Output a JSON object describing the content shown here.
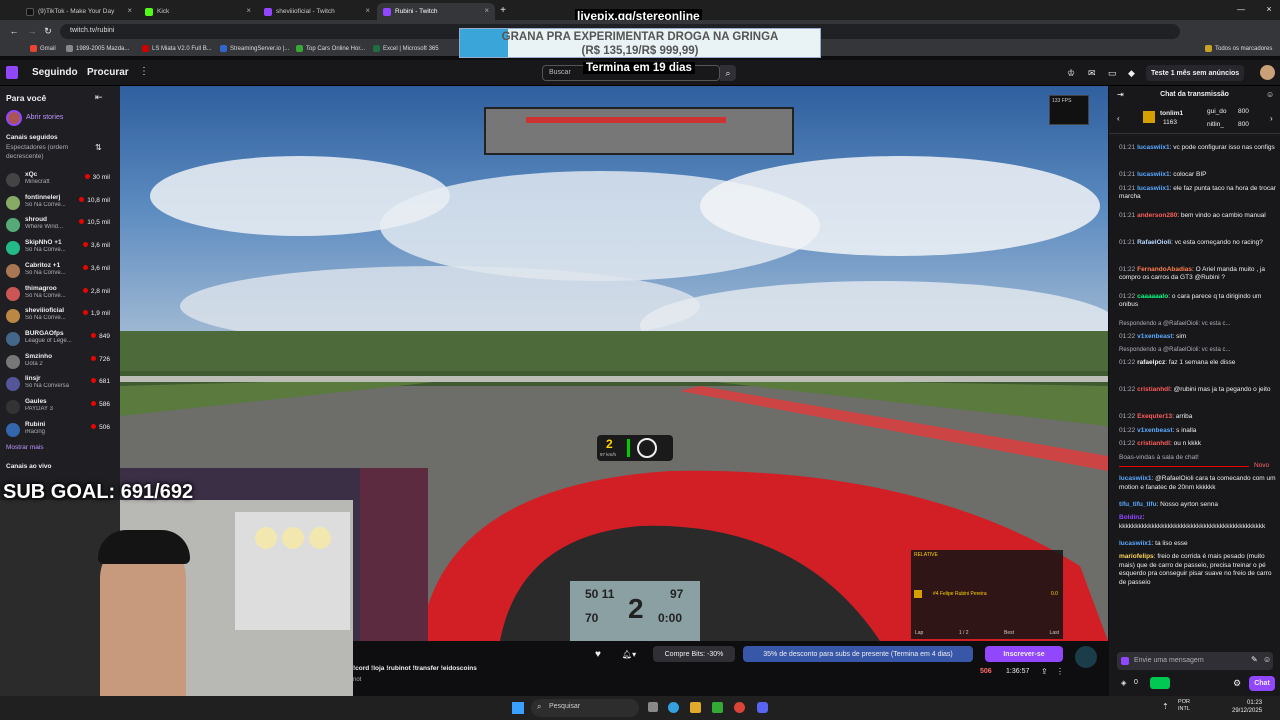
{
  "browser": {
    "tabs": [
      {
        "title": "(9)TikTok - Make Your Day",
        "color": "#111"
      },
      {
        "title": "Kick",
        "color": "#53fc18"
      },
      {
        "title": "sheviiioficial - Twitch",
        "color": "#9146ff"
      },
      {
        "title": "Rubini - Twitch",
        "color": "#9146ff"
      }
    ],
    "url": "twitch.tv/rubini",
    "bookmarks": [
      "Gmail",
      "1989-2005 Mazda...",
      "LS Miata V2.0 Full B...",
      "StreamingServer.io |...",
      "Top Cars Online Hor...",
      "Excel | Microsoft 365"
    ],
    "all_bookmarks": "Todos os marcadores"
  },
  "overlay": {
    "site": "livepix.gg/stereonline",
    "donation_line1": "GRANA PRA EXPERIMENTAR DROGA NA GRINGA",
    "donation_line2": "(R$ 135,19/R$ 999,99)",
    "countdown": "Termina em 19 dias",
    "sub_goal": "SUB GOAL: 691/692"
  },
  "topnav": {
    "following": "Seguindo",
    "browse": "Procurar",
    "search_placeholder": "Buscar",
    "ad_free": "Teste 1 mês sem anúncios"
  },
  "sidebar": {
    "for_you": "Para você",
    "stories": "Abrir stories",
    "followed": "Canais seguidos",
    "sort": "Espectadores (ordem decrescente)",
    "channels": [
      {
        "name": "xQc",
        "game": "Minecraft",
        "viewers": "30 mil",
        "color": "#444"
      },
      {
        "name": "fontinnelerj",
        "game": "Só Na Conve...",
        "viewers": "10,8 mil",
        "color": "#8a6"
      },
      {
        "name": "shroud",
        "game": "Where Wind...",
        "viewers": "10,5 mil",
        "color": "#5a7"
      },
      {
        "name": "SkipNhO +1",
        "game": "Só Na Conve...",
        "viewers": "3,6 mil",
        "color": "#2b8"
      },
      {
        "name": "Cabritoz +1",
        "game": "Só Na Conve...",
        "viewers": "3,6 mil",
        "color": "#a75"
      },
      {
        "name": "thimagroo",
        "game": "Só Na Conve...",
        "viewers": "2,8 mil",
        "color": "#c55"
      },
      {
        "name": "sheviiioficial",
        "game": "Só Na Conve...",
        "viewers": "1,9 mil",
        "color": "#b84"
      },
      {
        "name": "BURGAOfps",
        "game": "League of Lege...",
        "viewers": "849",
        "color": "#468"
      },
      {
        "name": "Smzinho",
        "game": "Dota 2",
        "viewers": "726",
        "color": "#777"
      },
      {
        "name": "linsjr",
        "game": "Só Na Conversa",
        "viewers": "681",
        "color": "#559"
      },
      {
        "name": "Gaules",
        "game": "PAYDAY 3",
        "viewers": "586",
        "color": "#333"
      },
      {
        "name": "Rubini",
        "game": "iRacing",
        "viewers": "506",
        "color": "#36a"
      }
    ],
    "show_more": "Mostrar mais",
    "live_channels": "Canais ao vivo"
  },
  "game": {
    "gear": "2",
    "speed": "97 km/h",
    "fps": "133 FPS",
    "relative_title": "RELATIVE",
    "driver": "#4 Felipe Rubini Pereira",
    "driver_gap": "0.0",
    "dash_left1": "50 11",
    "dash_left2": "70",
    "dash_gear": "2",
    "dash_right1": "97",
    "dash_right2": "0:00",
    "relative_footer": [
      "Lap",
      "1 / 2",
      "Best",
      "Last"
    ]
  },
  "stream_bar": {
    "commands": "!cord !loja !rubinot !transfer !eidoscoins",
    "sub_text": "not",
    "bits": "Compre Bits: -30%",
    "promo": "35% de desconto para subs de presente (Termina em 4 dias)",
    "subscribe": "Inscrever-se",
    "viewers": "506",
    "uptime": "1:36:57"
  },
  "chat": {
    "title": "Chat da transmissão",
    "top_users": [
      {
        "name": "tonlim1",
        "score": "1163"
      },
      {
        "name": "gui_do",
        "score": "800"
      },
      {
        "name": "nitlin_",
        "score": "800"
      }
    ],
    "messages": [
      {
        "time": "01:21",
        "user": "lucaswiix1",
        "color": "#5aaaff",
        "text": "vc pode configurar isso nas configs"
      },
      {
        "time": "01:21",
        "user": "lucaswiix1",
        "color": "#5aaaff",
        "text": "colocar BIP"
      },
      {
        "time": "01:21",
        "user": "lucaswiix1",
        "color": "#5aaaff",
        "text": "ele faz punta taco na hora de trocar marcha"
      },
      {
        "time": "01:21",
        "user": "anderson280",
        "color": "#ff5c5c",
        "text": "bem vindo ao cambio manual"
      },
      {
        "time": "01:21",
        "user": "RafaelOioli",
        "color": "#b8d8ff",
        "text": "vc esta começando no racing?"
      },
      {
        "time": "01:22",
        "user": "FernandoAbadias",
        "color": "#ff7f50",
        "text": "O Ariel manda muito , ja compro os carros da GT3 @Rubini ?"
      },
      {
        "time": "01:22",
        "user": "caaaaaalo",
        "color": "#00ff7f",
        "text": "o cara parece q ta dirigindo um onibus"
      },
      {
        "time": "01:22",
        "user": "v1xenbeast",
        "color": "#5aaaff",
        "text": "sim",
        "reply": "Respondendo a @RafaelOioli: vc esta c..."
      },
      {
        "time": "01:22",
        "user": "rafaelpcz",
        "color": "#efeff1",
        "text": "faz 1 semana ele disse",
        "reply": "Respondendo a @RafaelOioli: vc esta c..."
      },
      {
        "time": "01:22",
        "user": "cristianhdl",
        "color": "#ff5c5c",
        "text": "@rubini mas ja ta pegando o jeito"
      },
      {
        "time": "01:22",
        "user": "Exequter13",
        "color": "#ff5c5c",
        "text": "arriba"
      },
      {
        "time": "01:22",
        "user": "v1xenbeast",
        "color": "#5aaaff",
        "text": "s inalla"
      },
      {
        "time": "01:22",
        "user": "cristianhdl",
        "color": "#ff5c5c",
        "text": "ou n kkkk"
      }
    ],
    "welcome": "Boas-vindas à sala de chat!",
    "new_label": "Novo",
    "new_messages": [
      {
        "user": "lucaswiix1",
        "color": "#5aaaff",
        "text": "@RafaelOioli cara ta comecando com um motion e fanatec de 20nm kkkkkk"
      },
      {
        "user": "tifu_tifu_tifu",
        "color": "#5aaaff",
        "text": "Nosso ayrton senna"
      },
      {
        "user": "Boldinz",
        "color": "#9146ff",
        "text": "kkkkkkkkkkkkkkkkkkkkkkkkkkkkkkkkkkkkkkkkkkkkk"
      },
      {
        "user": "lucaswiix1",
        "color": "#5aaaff",
        "text": "ta liso esse"
      },
      {
        "user": "mariofelips",
        "color": "#ffd45a",
        "text": "freio de corrida é mais pesado (muito mais) que de carro de passeio, precisa treinar o pé esquerdo pra conseguir pisar suave no freio de carro de passeio"
      }
    ],
    "input_placeholder": "Envie uma mensagem",
    "points": "0",
    "chat_button": "Chat"
  },
  "taskbar": {
    "search": "Pesquisar",
    "lang": "POR INTL",
    "time": "01:23",
    "date": "29/12/2025"
  },
  "colors": {
    "twitch": "#9146ff",
    "live": "#eb0400",
    "accent_green": "#00c853"
  }
}
